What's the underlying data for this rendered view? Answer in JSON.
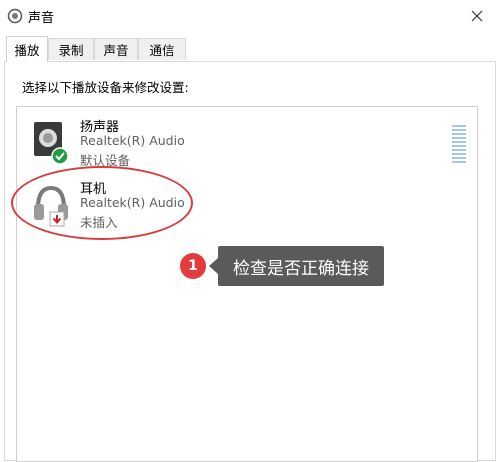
{
  "window": {
    "title": "声音",
    "icon": "speaker-icon"
  },
  "tabs": [
    {
      "label": "播放",
      "active": true
    },
    {
      "label": "录制",
      "active": false
    },
    {
      "label": "声音",
      "active": false
    },
    {
      "label": "通信",
      "active": false
    }
  ],
  "instruction": "选择以下播放设备来修改设置:",
  "devices": [
    {
      "name": "扬声器",
      "driver": "Realtek(R) Audio",
      "status": "默认设备",
      "icon": "speaker-device-icon",
      "badge": "default-check-icon"
    },
    {
      "name": "耳机",
      "driver": "Realtek(R) Audio",
      "status": "未插入",
      "icon": "headphones-icon",
      "badge": "unplugged-arrow-icon"
    }
  ],
  "callout": {
    "number": "1",
    "text": "检查是否正确连接"
  },
  "colors": {
    "highlight": "#d83c3c",
    "callout_bg": "#5a5a5a",
    "badge_green": "#1e9e3e",
    "badge_red": "#d02020"
  }
}
